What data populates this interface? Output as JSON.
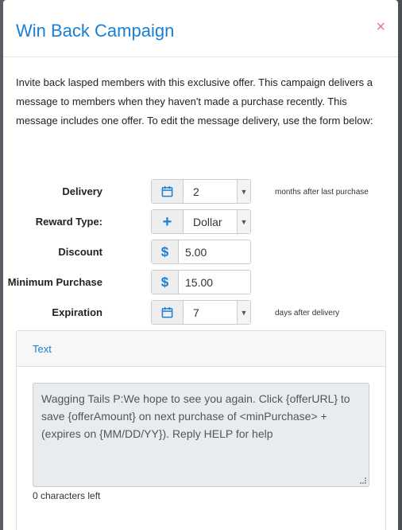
{
  "modal": {
    "title": "Win Back Campaign",
    "close_label": "×",
    "description": "Invite back lasped members with this exclusive offer. This campaign delivers a message to members when they haven't made a purchase recently. This message includes one offer. To edit the message delivery, use the form below:"
  },
  "form": {
    "delivery": {
      "label": "Delivery",
      "value": "2",
      "suffix": "months after last purchase",
      "icon": "calendar-icon"
    },
    "reward_type": {
      "label": "Reward Type:",
      "value": "Dollar",
      "icon": "plus-icon"
    },
    "discount": {
      "label": "Discount",
      "value": "5.00",
      "icon_glyph": "$"
    },
    "minimum_purchase": {
      "label": "Minimum Purchase",
      "value": "15.00",
      "icon_glyph": "$"
    },
    "expiration": {
      "label": "Expiration",
      "value": "7",
      "suffix": "days after delivery",
      "icon": "calendar-icon"
    }
  },
  "message_panel": {
    "tab_label": "Text",
    "message": "Wagging Tails P:We hope to see you again. Click {offerURL} to save {offerAmount} on next purchase of <minPurchase> + (expires on {MM/DD/YY}). Reply HELP for help",
    "chars_left": "0 characters left"
  },
  "colors": {
    "accent": "#1a7fd4",
    "close": "#e07b7b",
    "backdrop": "#5a5f66"
  }
}
